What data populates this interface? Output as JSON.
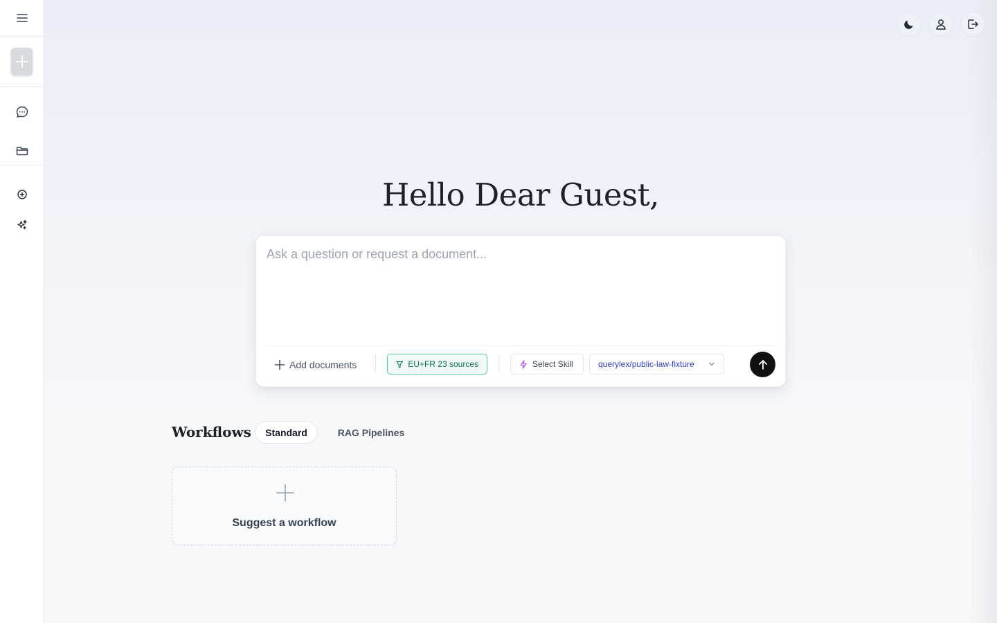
{
  "greeting": "Hello Dear Guest,",
  "composer": {
    "placeholder": "Ask a question or request a document...",
    "add_documents": "Add documents",
    "filter_chip": "EU+FR 23 sources",
    "skill_chip": "Select Skill",
    "model_chip": "querylex/public-law-fixture"
  },
  "workflows": {
    "title": "Workflows",
    "tabs": [
      {
        "label": "Standard",
        "active": true
      },
      {
        "label": "RAG Pipelines",
        "active": false
      }
    ],
    "suggest_label": "Suggest a workflow"
  },
  "sidebar": {
    "icons": [
      "menu-icon",
      "new-chat-plus-icon",
      "chat-bubble-icon",
      "folder-icon",
      "circle-plus-icon",
      "sparkles-icon"
    ]
  },
  "header": {
    "icons": [
      "moon-icon",
      "user-icon",
      "logout-icon"
    ]
  },
  "colors": {
    "filter_accent": "#5cc6aa",
    "model_text": "#2f3fc4",
    "send_button": "#111111",
    "skill_icon": "#a855f7"
  }
}
